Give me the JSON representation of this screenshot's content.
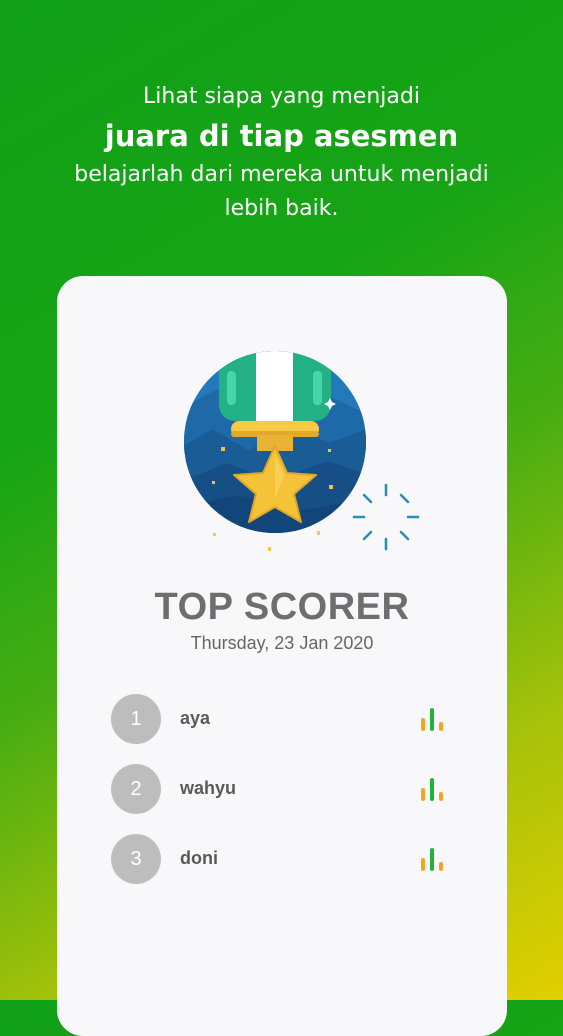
{
  "header": {
    "line1": "Lihat siapa yang menjadi",
    "line2": "juara di tiap asesmen",
    "line3": "belajarlah dari mereka untuk menjadi lebih baik."
  },
  "card": {
    "title": "TOP SCORER",
    "date": "Thursday, 23 Jan 2020",
    "scorers": [
      {
        "rank": "1",
        "name": "aya"
      },
      {
        "rank": "2",
        "name": "wahyu"
      },
      {
        "rank": "3",
        "name": "doni"
      }
    ]
  },
  "icons": {
    "medal": "medal-star-icon",
    "sparkle": "sparkle-burst-icon",
    "stats": "bar-chart-icon"
  },
  "colors": {
    "gradient_start": "#109f17",
    "gradient_end": "#e2cf00",
    "bar_orange": "#f4a424",
    "bar_green": "#1fb33a"
  }
}
